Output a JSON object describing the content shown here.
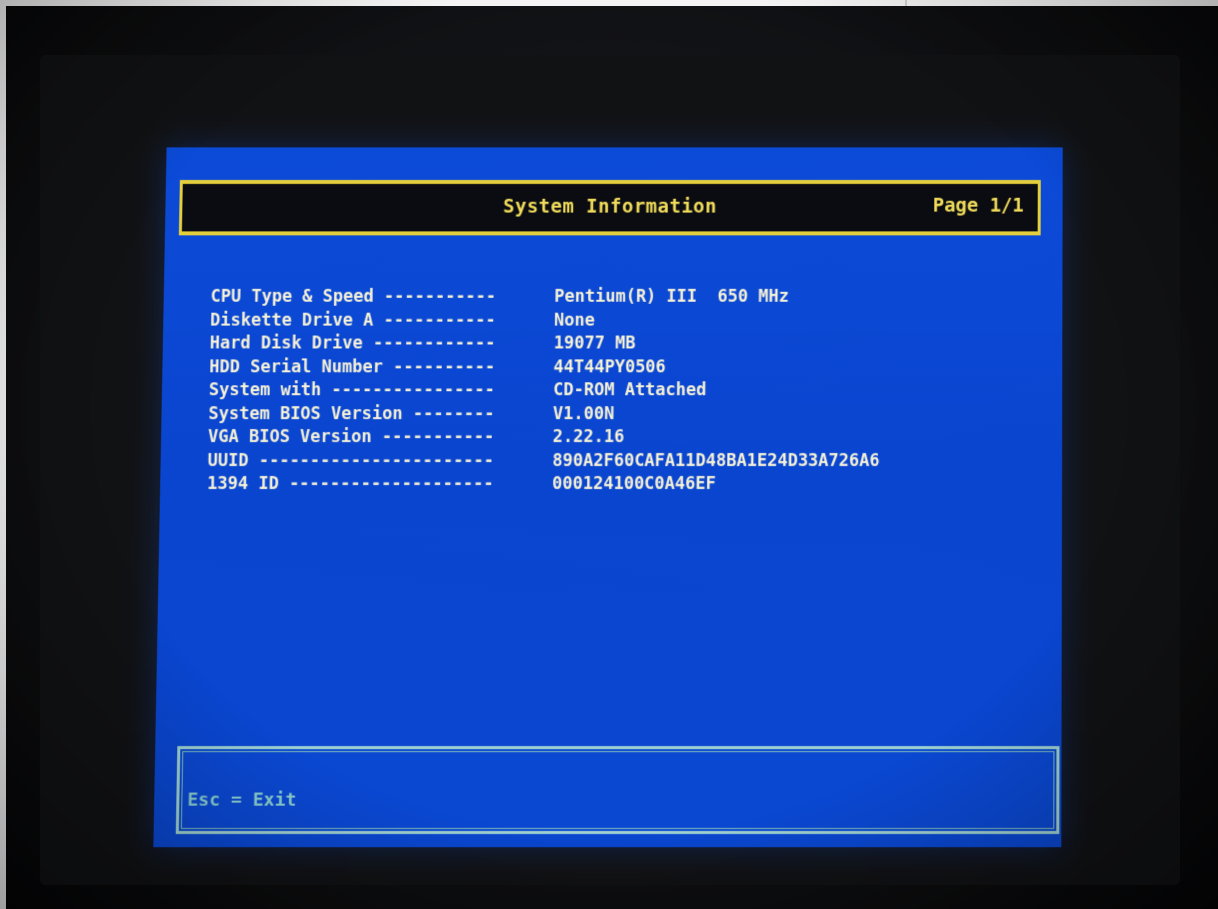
{
  "header": {
    "title": "System Information",
    "page": "Page 1/1"
  },
  "info": {
    "rows": [
      {
        "label": "CPU Type & Speed -----------",
        "value": "Pentium(R) III  650 MHz"
      },
      {
        "label": "Diskette Drive A -----------",
        "value": "None"
      },
      {
        "label": "Hard Disk Drive ------------",
        "value": "19077 MB"
      },
      {
        "label": "HDD Serial Number ----------",
        "value": "44T44PY0506"
      },
      {
        "label": "System with ----------------",
        "value": "CD-ROM Attached"
      },
      {
        "label": "System BIOS Version --------",
        "value": "V1.00N"
      },
      {
        "label": "VGA BIOS Version -----------",
        "value": "2.22.16"
      },
      {
        "label": "UUID -----------------------",
        "value": "890A2F60CAFA11D48BA1E24D33A726A6"
      },
      {
        "label": "1394 ID --------------------",
        "value": "000124100C0A46EF"
      }
    ]
  },
  "footer": {
    "hint": "Esc = Exit"
  },
  "colors": {
    "screen_blue": "#0a47d0",
    "title_yellow": "#e5d03c",
    "text_cream": "#f6f2d8",
    "footer_cyan": "#9fd2d0",
    "bezel_black": "#111214"
  }
}
